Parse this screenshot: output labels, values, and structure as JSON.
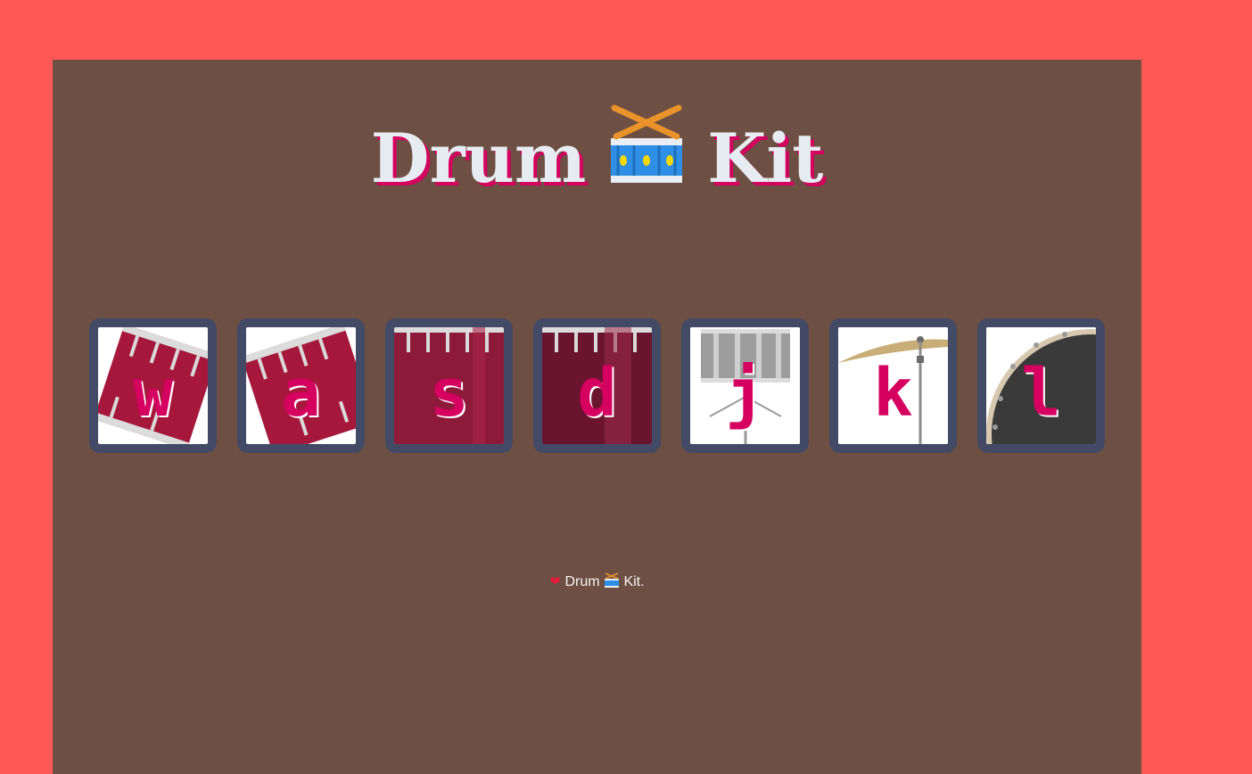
{
  "header": {
    "title_left": "Drum",
    "title_icon": "drum-with-drumsticks-icon",
    "title_right": "Kit"
  },
  "pads": [
    {
      "key": "w",
      "instrument_icon": "tom-drum-icon"
    },
    {
      "key": "a",
      "instrument_icon": "tom-drum-icon"
    },
    {
      "key": "s",
      "instrument_icon": "tom-drum-icon"
    },
    {
      "key": "d",
      "instrument_icon": "tom-drum-icon"
    },
    {
      "key": "j",
      "instrument_icon": "snare-drum-icon"
    },
    {
      "key": "k",
      "instrument_icon": "cymbal-icon"
    },
    {
      "key": "l",
      "instrument_icon": "bass-drum-icon"
    }
  ],
  "footer": {
    "heart": "❤",
    "text_left": "Drum",
    "icon": "drum-icon",
    "text_right": "Kit."
  },
  "colors": {
    "page_background": "#ff5656",
    "panel_background": "#6d4f44",
    "pad_border": "#424a66",
    "accent": "#d5005f",
    "title_text": "#e6ecf1"
  }
}
